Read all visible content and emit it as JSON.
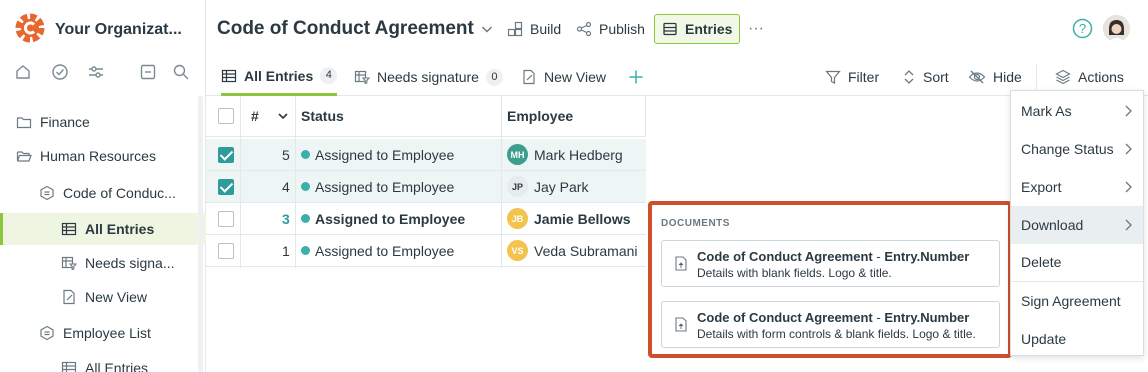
{
  "app": {
    "org_name": "Your Organizat...",
    "brand_color": "#e8672e",
    "accent_color": "#8cc63f",
    "icons": [
      "home-icon",
      "check-circle-icon",
      "sliders-icon",
      "collapse-icon",
      "search-icon"
    ]
  },
  "sidebar": {
    "items": [
      {
        "label": "Finance",
        "icon": "folder-icon"
      },
      {
        "label": "Human Resources",
        "icon": "folder-open-icon"
      },
      {
        "label": "Code of Conduc...",
        "icon": "form-icon"
      },
      {
        "label": "All Entries",
        "icon": "table-icon"
      },
      {
        "label": "Needs signa...",
        "icon": "filtered-table-icon"
      },
      {
        "label": "New View",
        "icon": "view-edit-icon"
      },
      {
        "label": "Employee List",
        "icon": "form-icon"
      },
      {
        "label": "All Entries",
        "icon": "table-icon"
      }
    ]
  },
  "header": {
    "form_title": "Code of Conduct Agreement",
    "build": "Build",
    "publish": "Publish",
    "entries": "Entries",
    "more": "···"
  },
  "views": {
    "tabs": [
      {
        "label": "All Entries",
        "count": "4"
      },
      {
        "label": "Needs signature",
        "count": "0"
      },
      {
        "label": "New View",
        "count": ""
      }
    ],
    "add": "+",
    "filter": "Filter",
    "sort": "Sort",
    "hide": "Hide",
    "actions": "Actions"
  },
  "table": {
    "columns": {
      "num": "#",
      "status": "Status",
      "employee": "Employee"
    },
    "rows": [
      {
        "num": "5",
        "status": "Assigned to Employee",
        "initials": "MH",
        "employee": "Mark Hedberg",
        "checked": true
      },
      {
        "num": "4",
        "status": "Assigned to Employee",
        "initials": "JP",
        "employee": "Jay Park",
        "checked": true
      },
      {
        "num": "3",
        "status": "Assigned to Employee",
        "initials": "JB",
        "employee": "Jamie Bellows",
        "checked": false
      },
      {
        "num": "1",
        "status": "Assigned to Employee",
        "initials": "VS",
        "employee": "Veda Subramani",
        "checked": false
      }
    ]
  },
  "documents": {
    "title": "DOCUMENTS",
    "items": [
      {
        "name": "Code of Conduct Agreement",
        "sep": " - ",
        "suffix": "Entry.Number",
        "desc": "Details with blank fields. Logo & title."
      },
      {
        "name": "Code of Conduct Agreement",
        "sep": " - ",
        "suffix": "Entry.Number",
        "desc": "Details with form controls & blank fields. Logo & title."
      }
    ]
  },
  "actions_menu": {
    "items": [
      "Mark As",
      "Change Status",
      "Export",
      "Download",
      "Delete",
      "Sign Agreement",
      "Update"
    ],
    "highlighted": "Download"
  }
}
